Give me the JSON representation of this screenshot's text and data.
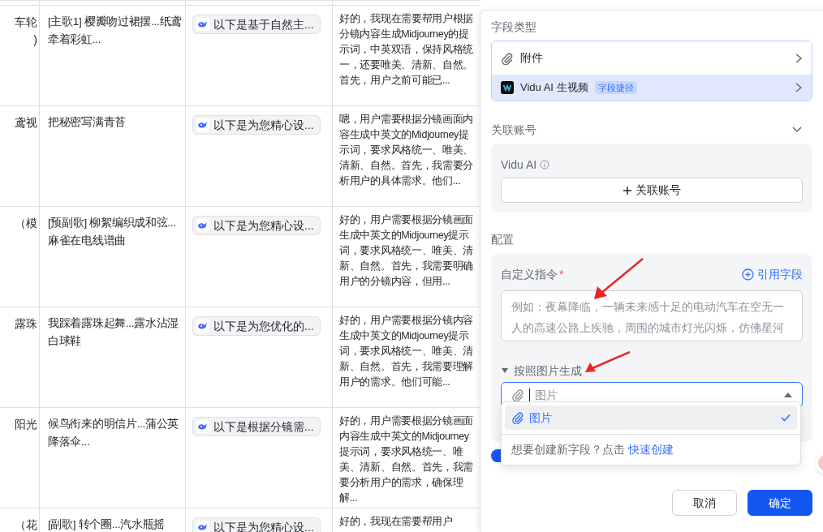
{
  "table": {
    "rows": [
      {
        "col_1": [
          "车轮",
          ")"
        ],
        "col_2": "[主歌1] 樱瓣吻过裙摆...纸鸢牵着彩虹...",
        "col_3": "以下是基于自然主...",
        "col_4": "好的，我现在需要帮用户根据分镜内容生成Midjourney的提示词，中英双语，保持风格统一，还要唯美、清新、自然。首先，用户之前可能已..."
      },
      {
        "col_1": [
          "鸢视"
        ],
        "col_2": "把秘密写满青苔",
        "col_3": "以下是为您精心设...",
        "col_4": "嗯，用户需要根据分镜画面内容生成中英文的Midjourney提示词，要求风格统一、唯美、清新、自然。首先，我需要分析用户的具体需求。他们..."
      },
      {
        "col_1": [
          "（模"
        ],
        "col_2": "[预副歌] 柳絮编织成和弦...麻雀在电线谱曲",
        "col_3": "以下是为您精心设...",
        "col_4": "好的，用户需要根据分镜画面生成中英文的Midjourney提示词，要求风格统一、唯美、清新、自然。首先，我需要明确用户的分镜内容，但用..."
      },
      {
        "col_1": [
          "露珠"
        ],
        "col_2": "我踩着露珠起舞...露水沾湿白球鞋",
        "col_3": "以下是为您优化的...",
        "col_4": "好的，用户需要根据分镜内容生成中英文的Midjourney提示词，要求风格统一、唯美、清新、自然。首先，我需要理解用户的需求。他们可能..."
      },
      {
        "col_1": [
          "阳光"
        ],
        "col_2": "候鸟衔来的明信片...蒲公英降落伞...",
        "col_3": "以下是根据分镜需...",
        "col_4": "好的，用户需要根据分镜画面内容生成中英文的Midjourney提示词，要求风格统一、唯美、清新、自然。首先，我需要分析用户的需求，确保理解..."
      },
      {
        "col_1": [
          "（花"
        ],
        "col_2": "[副歌] 转个圈...汽水瓶摇",
        "col_3": "以下是为您精心设...",
        "col_4": "好的，我现在需要帮用户"
      }
    ]
  },
  "panel": {
    "field_type": {
      "title": "字段类型",
      "options": [
        {
          "label": "附件",
          "kind": "attachment",
          "selected": false
        },
        {
          "label": "Vidu AI 生视频",
          "kind": "vidu",
          "badge": "字段捷径",
          "selected": true
        }
      ]
    },
    "account": {
      "title": "关联账号",
      "expanded": true,
      "service": "Vidu AI",
      "button": "关联账号"
    },
    "config": {
      "title": "配置",
      "instruction_label": "自定义指令",
      "required_mark": "*",
      "reference_button": "引用字段",
      "instruction_placeholder": "例如：夜幕降临，一辆未来感十足的电动汽车在空无一人的高速公路上疾驰，周围的城市灯光闪烁，仿佛星河",
      "image_section": {
        "label": "按照图片生成",
        "expanded": true,
        "field_placeholder": "图片"
      }
    },
    "dropdown": {
      "options": [
        {
          "label": "图片",
          "selected": true
        }
      ],
      "footer_text": "想要创建新字段？点击",
      "footer_link": "快速创建"
    },
    "auto_update": {
      "on": true
    },
    "buttons": [
      {
        "label": "取消",
        "kind": "secondary"
      },
      {
        "label": "确定",
        "kind": "primary"
      }
    ]
  }
}
